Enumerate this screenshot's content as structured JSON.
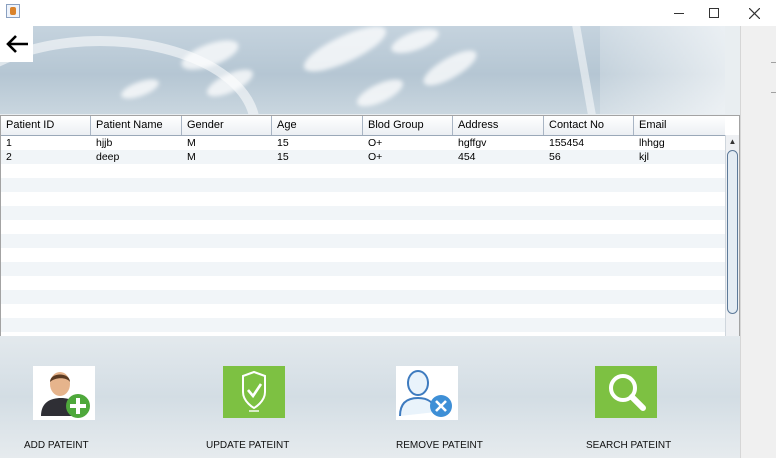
{
  "window": {
    "title": "",
    "controls": [
      "minimize",
      "maximize",
      "close"
    ]
  },
  "back_icon": "arrow-left-icon",
  "table": {
    "columns": [
      "Patient ID",
      "Patient Name",
      "Gender",
      "Age",
      "Blod Group",
      "Address",
      "Contact No",
      "Email"
    ],
    "rows": [
      [
        "1",
        "hjjb",
        "M",
        "15",
        "O+",
        "hgffgv",
        "155454",
        "lhhgg"
      ],
      [
        "2",
        "deep",
        "M",
        "15",
        "O+",
        "454",
        "56",
        "kjl"
      ]
    ]
  },
  "actions": [
    {
      "label": "ADD PATEINT",
      "icon": "add-user-icon"
    },
    {
      "label": "UPDATE PATEINT",
      "icon": "update-check-icon"
    },
    {
      "label": "REMOVE PATEINT",
      "icon": "remove-user-icon"
    },
    {
      "label": "SEARCH PATEINT",
      "icon": "search-icon"
    }
  ],
  "colors": {
    "update_tile": "#7dc142",
    "search_tile": "#7dc142",
    "header_border": "#9aa8b8"
  }
}
